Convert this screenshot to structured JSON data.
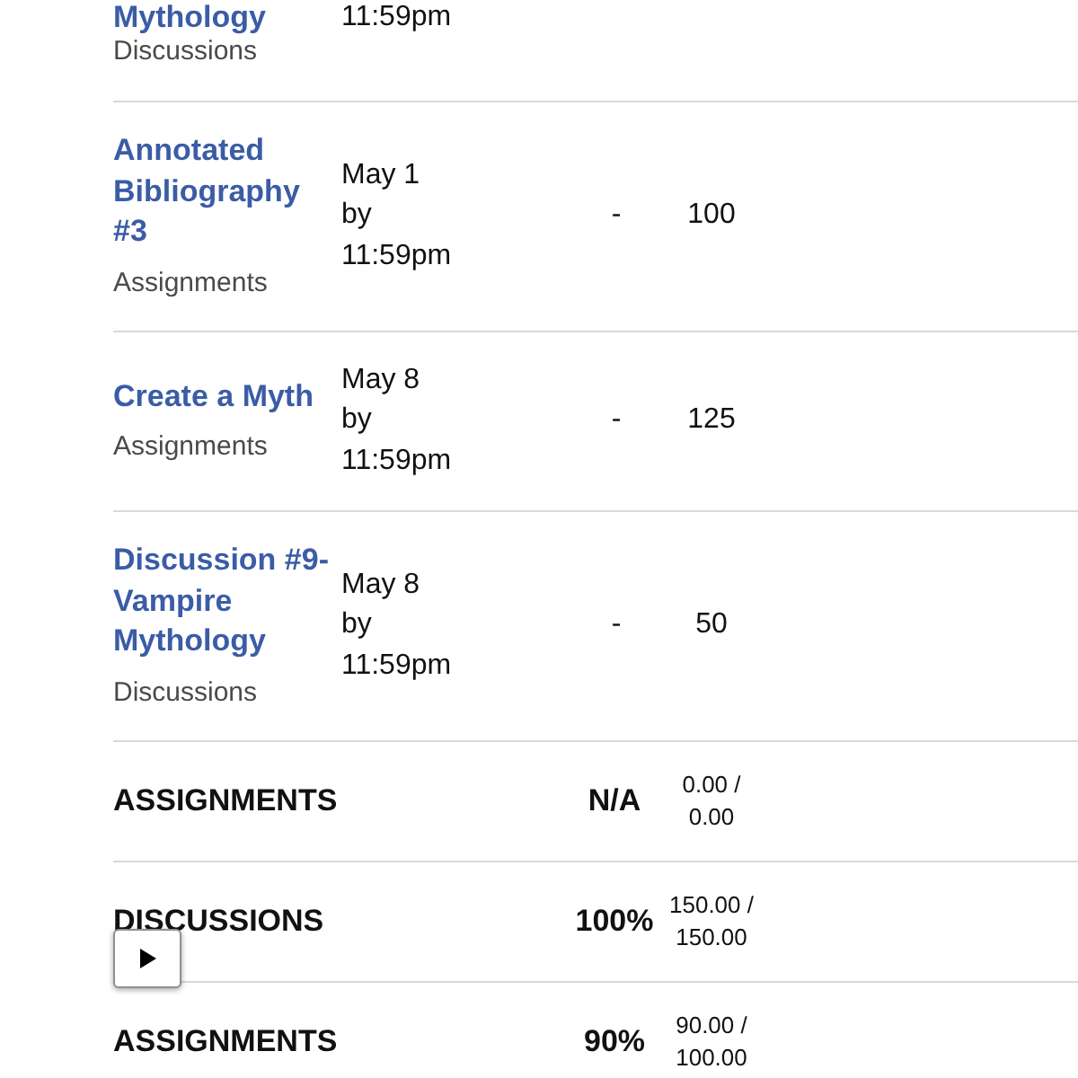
{
  "assignments": [
    {
      "title": "Mythology",
      "category": "Discussions",
      "due": [
        "11:59pm"
      ]
    },
    {
      "title": "Annotated Bibliography #3",
      "category": "Assignments",
      "due": [
        "May 1",
        "by",
        "11:59pm"
      ],
      "score": "-",
      "points": "100"
    },
    {
      "title": "Create a Myth",
      "category": "Assignments",
      "due": [
        "May 8",
        "by",
        "11:59pm"
      ],
      "score": "-",
      "points": "125"
    },
    {
      "title": "Discussion #9-Vampire Mythology",
      "category": "Discussions",
      "due": [
        "May 8",
        "by",
        "11:59pm"
      ],
      "score": "-",
      "points": "50"
    }
  ],
  "totals": [
    {
      "name": "ASSIGNMENTS",
      "percent": "N/A",
      "score": "0.00 / 0.00"
    },
    {
      "name": "DISCUSSIONS",
      "percent": "100%",
      "score": "150.00 / 150.00"
    },
    {
      "name": "ASSIGNMENTS",
      "percent": "90%",
      "score": "90.00 / 100.00"
    }
  ]
}
